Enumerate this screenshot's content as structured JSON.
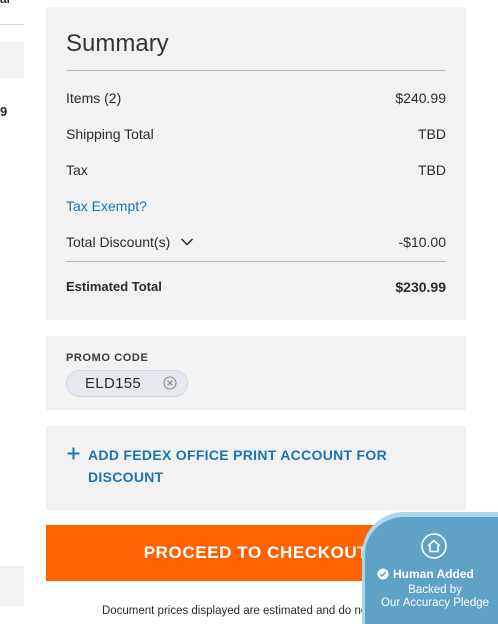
{
  "left_column": {
    "top_fragment": "al",
    "price_fragment": "9"
  },
  "summary": {
    "title": "Summary",
    "items_label": "Items (2)",
    "items_value": "$240.99",
    "shipping_label": "Shipping Total",
    "shipping_value": "TBD",
    "tax_label": "Tax",
    "tax_value": "TBD",
    "tax_exempt_link": "Tax Exempt?",
    "discount_label": "Total Discount(s)",
    "discount_value": "-$10.00",
    "total_label": "Estimated Total",
    "total_value": "$230.99"
  },
  "promo": {
    "heading": "PROMO CODE",
    "code": "ELD155"
  },
  "fedex_account": {
    "link_line1": "ADD FEDEX OFFICE PRINT ACCOUNT FOR",
    "link_line2": "DISCOUNT"
  },
  "checkout": {
    "button_label": "PROCEED TO CHECKOUT"
  },
  "disclaimer": "Document prices displayed are estimated and do not include",
  "badge": {
    "line1": "Human Added",
    "line2a": "Backed by",
    "line2b": "Our Accuracy Pledge"
  },
  "colors": {
    "accent_orange": "#ff6200",
    "link_blue": "#1a73b5",
    "card_gray": "#f2f2f2",
    "badge_blue": "#5ea3c6"
  },
  "icons": {
    "chevron": "chevron-down-icon",
    "promo_remove": "close-circle-icon",
    "plus": "plus-icon",
    "badge_house": "house-icon",
    "badge_check": "check-circle-icon"
  }
}
